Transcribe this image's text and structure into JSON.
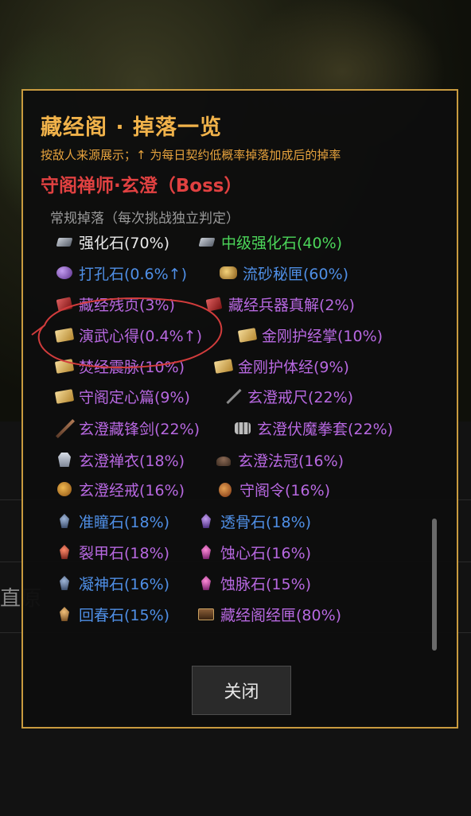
{
  "dialog": {
    "title": "藏经阁 · 掉落一览",
    "subtitle": "按敌人来源展示；↑ 为每日契约低概率掉落加成后的掉率",
    "boss_name": "守阁禅师·玄澄（Boss）",
    "section_label": "常规掉落（每次挑战独立判定）",
    "close_label": "关闭"
  },
  "background": {
    "partial_text": "直原"
  },
  "colors": {
    "title": "#f0b24a",
    "boss": "#e14141",
    "common": "#e8e8e8",
    "uncommon": "#4cd65a",
    "rare": "#4f8fe6",
    "epic": "#b768e0",
    "border": "#c99b3f",
    "annotation": "#d23c3c"
  },
  "drops": [
    {
      "label": "强化石(70%)",
      "rarity": "white",
      "icon": "stone-icon"
    },
    {
      "label": "中级强化石(40%)",
      "rarity": "green",
      "icon": "stone-icon"
    },
    {
      "label": "打孔石(0.6%↑)",
      "rarity": "blue",
      "icon": "orb-icon"
    },
    {
      "label": "流砂秘匣(60%)",
      "rarity": "blue",
      "icon": "box-icon"
    },
    {
      "label": "藏经残页(3%)",
      "rarity": "purple",
      "icon": "red-book-icon"
    },
    {
      "label": "藏经兵器真解(2%)",
      "rarity": "purple",
      "icon": "red-book-icon"
    },
    {
      "label": "演武心得(0.4%↑)",
      "rarity": "purple",
      "icon": "scroll-icon"
    },
    {
      "label": "金刚护经掌(10%)",
      "rarity": "purple",
      "icon": "scroll-icon"
    },
    {
      "label": "焚经震脉(10%)",
      "rarity": "purple",
      "icon": "scroll-icon"
    },
    {
      "label": "金刚护体经(9%)",
      "rarity": "purple",
      "icon": "scroll-icon"
    },
    {
      "label": "守阁定心篇(9%)",
      "rarity": "purple",
      "icon": "scroll-icon"
    },
    {
      "label": "玄澄戒尺(22%)",
      "rarity": "purple",
      "icon": "ruler-icon"
    },
    {
      "label": "玄澄藏锋剑(22%)",
      "rarity": "purple",
      "icon": "sword-icon"
    },
    {
      "label": "玄澄伏魔拳套(22%)",
      "rarity": "purple",
      "icon": "gloves-icon"
    },
    {
      "label": "玄澄禅衣(18%)",
      "rarity": "purple",
      "icon": "robe-icon"
    },
    {
      "label": "玄澄法冠(16%)",
      "rarity": "purple",
      "icon": "hat-icon"
    },
    {
      "label": "玄澄经戒(16%)",
      "rarity": "purple",
      "icon": "ring-icon"
    },
    {
      "label": "守阁令(16%)",
      "rarity": "purple",
      "icon": "token-icon"
    },
    {
      "label": "准瞳石(18%)",
      "rarity": "blue",
      "icon": "blue-crystal-icon"
    },
    {
      "label": "透骨石(18%)",
      "rarity": "blue",
      "icon": "violet-crystal-icon"
    },
    {
      "label": "裂甲石(18%)",
      "rarity": "purple",
      "icon": "red-crystal-icon"
    },
    {
      "label": "蚀心石(16%)",
      "rarity": "purple",
      "icon": "pink-crystal-icon"
    },
    {
      "label": "凝神石(16%)",
      "rarity": "blue",
      "icon": "blue-crystal-icon"
    },
    {
      "label": "蚀脉石(15%)",
      "rarity": "purple",
      "icon": "pink-crystal-icon"
    },
    {
      "label": "回春石(15%)",
      "rarity": "blue",
      "icon": "amber-crystal-icon"
    },
    {
      "label": "藏经阁经匣(80%)",
      "rarity": "purple",
      "icon": "chest-icon"
    }
  ]
}
